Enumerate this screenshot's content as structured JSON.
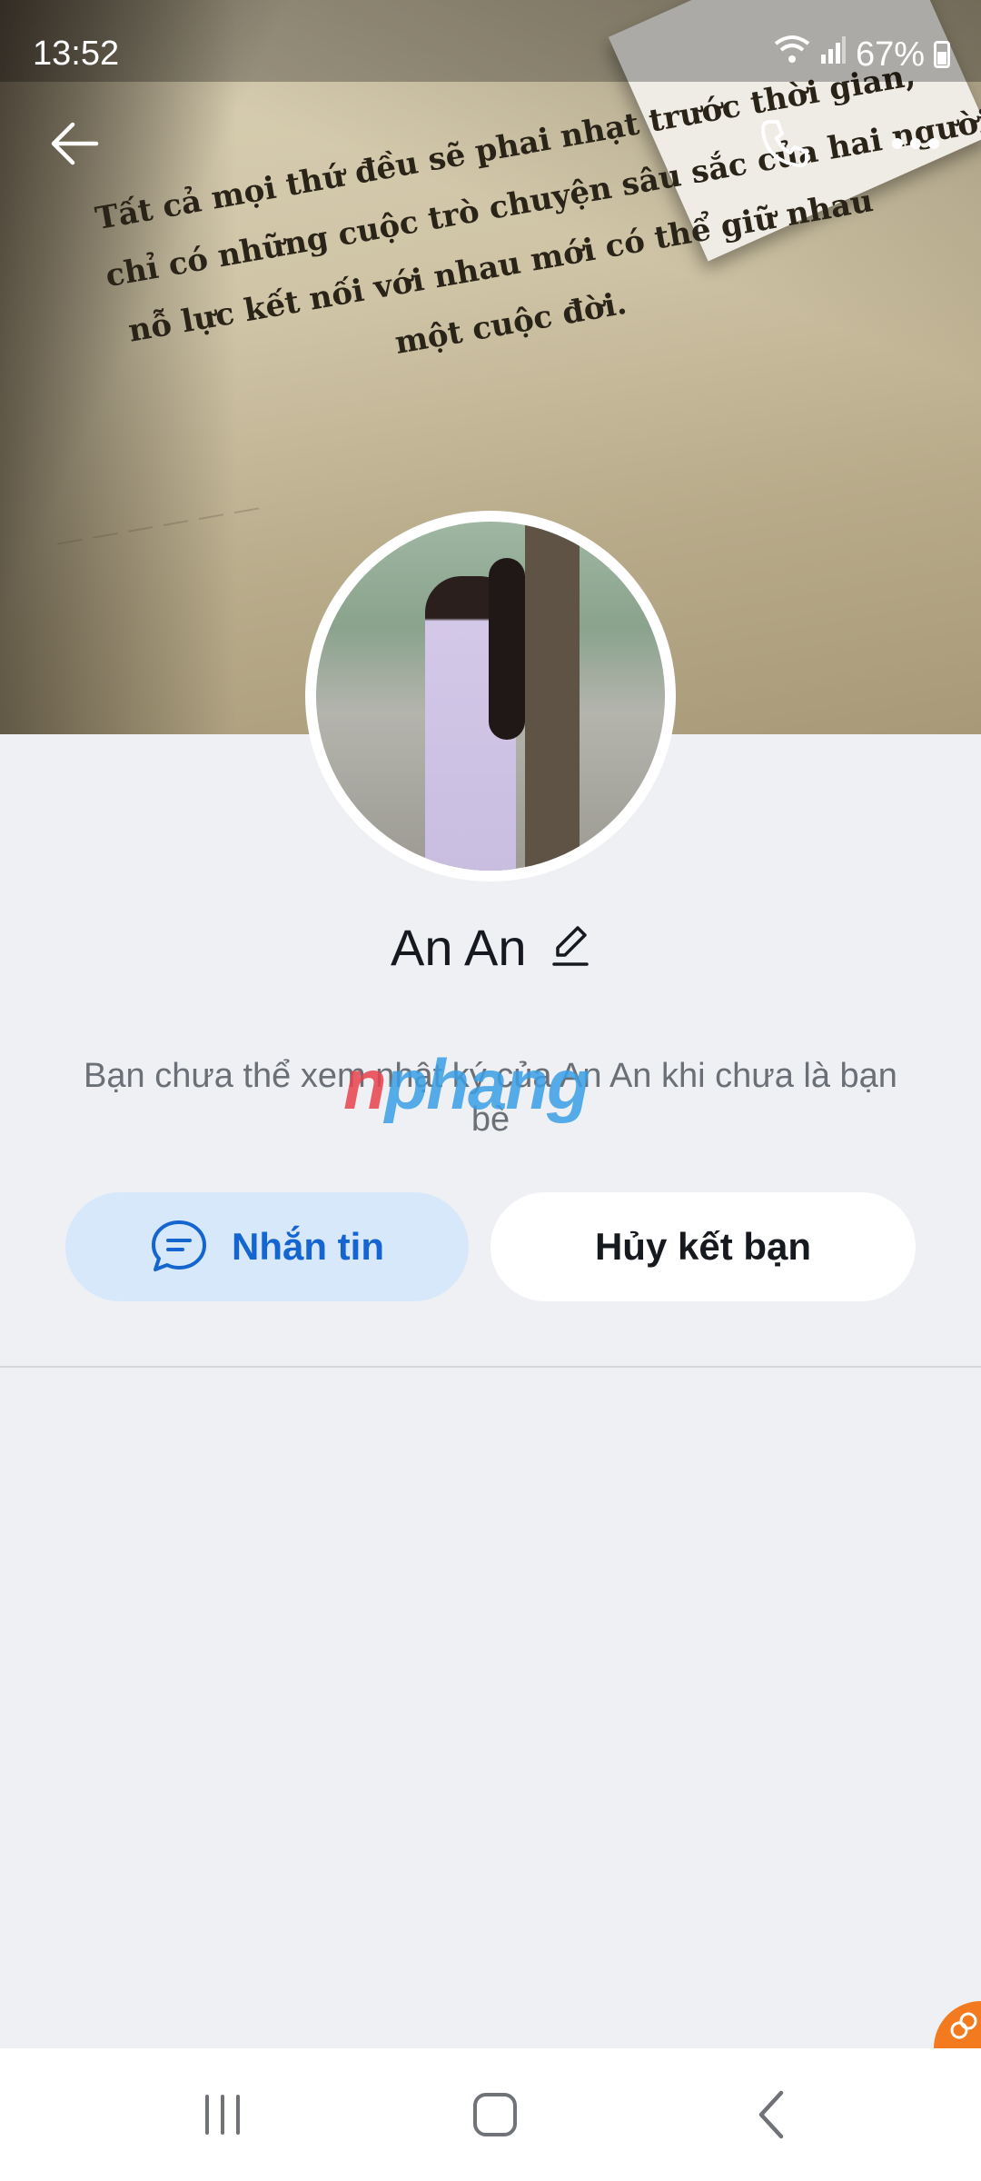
{
  "status_bar": {
    "time": "13:52",
    "battery": "67%"
  },
  "cover": {
    "quote_lines": [
      "Tất cả mọi thứ đều sẽ phai nhạt trước thời gian,",
      "chỉ có những cuộc trò chuyện sâu sắc của hai người",
      "nỗ lực kết nối với nhau mới có thể giữ nhau",
      "một cuộc đời."
    ]
  },
  "profile": {
    "name": "An An",
    "note": "Bạn chưa thể xem nhật ký của An An khi chưa là bạn bè"
  },
  "actions": {
    "message_label": "Nhắn tin",
    "unfriend_label": "Hủy kết bạn"
  },
  "watermark": {
    "part1": "n",
    "part2": "phang"
  },
  "icons": {
    "back": "arrow-left-icon",
    "call": "phone-icon",
    "more": "more-dots-icon",
    "edit": "pencil-icon",
    "message": "chat-bubble-icon"
  },
  "colors": {
    "accent": "#1465d0",
    "message_button_bg": "#d8e8fb",
    "page_bg": "#eff0f4"
  }
}
